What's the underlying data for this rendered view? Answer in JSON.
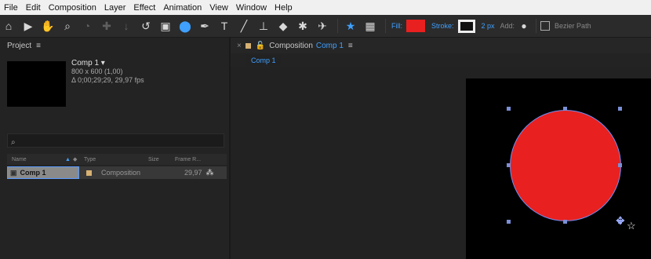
{
  "menu": [
    "File",
    "Edit",
    "Composition",
    "Layer",
    "Effect",
    "Animation",
    "View",
    "Window",
    "Help"
  ],
  "toolbar": {
    "fill_label": "Fill:",
    "fill_color": "#e8201f",
    "stroke_label": "Stroke:",
    "stroke_width": "2 px",
    "add_label": "Add:",
    "bezier_label": "Bezier Path"
  },
  "project": {
    "title": "Project",
    "comp_name": "Comp 1 ▾",
    "comp_size": "800 x 600 (1,00)",
    "comp_duration": "Δ 0;00;29;29, 29,97 fps",
    "search_placeholder": "",
    "columns": [
      "Name",
      "Type",
      "Size",
      "Frame R..."
    ],
    "items": [
      {
        "name": "Comp 1",
        "type": "Composition",
        "size": "",
        "frame_rate": "29,97"
      }
    ]
  },
  "composition": {
    "tab_prefix": "Composition",
    "tab_name": "Comp 1",
    "subtab": "Comp 1"
  }
}
